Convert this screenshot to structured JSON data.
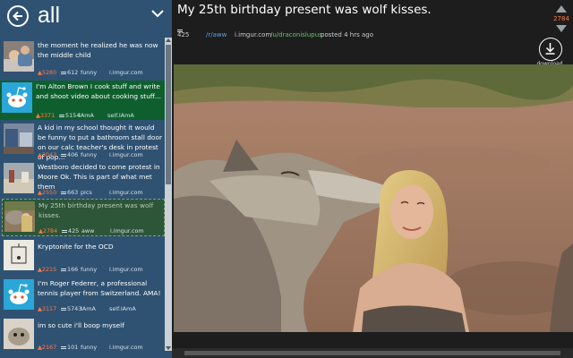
{
  "header": {
    "title": "all"
  },
  "posts": [
    {
      "title": "the moment he realized he was now the middle child",
      "score": "5280",
      "comments": "612",
      "subreddit": "funny",
      "domain": "i.imgur.com"
    },
    {
      "title": "I'm Alton Brown I cook stuff and write and shoot video about cooking stuff...",
      "score": "3371",
      "comments": "5154",
      "subreddit": "IAmA",
      "domain": "self.IAmA"
    },
    {
      "title": "A kid in my school thought it would be funny to put a bathroom stall door on our calc teacher's desk in protest of pop...",
      "score": "3043",
      "comments": "406",
      "subreddit": "funny",
      "domain": "i.imgur.com"
    },
    {
      "title": "Westboro decided to come protest in Moore Ok. This is part of what met them",
      "score": "2550",
      "comments": "663",
      "subreddit": "pics",
      "domain": "i.imgur.com"
    },
    {
      "title": "My 25th birthday present was wolf kisses.",
      "score": "2784",
      "comments": "425",
      "subreddit": "aww",
      "domain": "i.imgur.com"
    },
    {
      "title": "Kryptonite for the OCD",
      "score": "2215",
      "comments": "166",
      "subreddit": "funny",
      "domain": "i.imgur.com"
    },
    {
      "title": "I'm Roger Federer, a professional tennis player from Switzerland. AMA!",
      "score": "3117",
      "comments": "5743",
      "subreddit": "IAmA",
      "domain": "self.IAmA"
    },
    {
      "title": "im so cute i'll boop myself",
      "score": "2167",
      "comments": "101",
      "subreddit": "funny",
      "domain": "i.imgur.com"
    }
  ],
  "main": {
    "title": "My 25th birthday present was wolf kisses.",
    "comments": "425",
    "subreddit": "/r/aww",
    "domain": "i.imgur.com",
    "user": "/u/draconislupus",
    "posted": "posted 4 hrs ago",
    "score": "2784",
    "download_label": "download"
  },
  "colors": {
    "sidebar": "#2f5272",
    "active": "#0f5f2e",
    "score": "#ff7b46",
    "link": "#5ea0e6",
    "user": "#69c36a"
  }
}
